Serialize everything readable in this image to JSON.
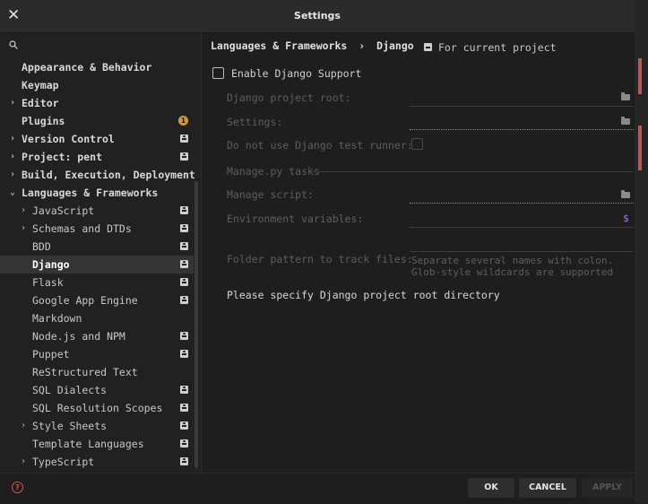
{
  "window": {
    "title": "Settings"
  },
  "search": {
    "placeholder": ""
  },
  "sidebar": {
    "items": [
      {
        "label": "Appearance & Behavior"
      },
      {
        "label": "Keymap"
      },
      {
        "label": "Editor"
      },
      {
        "label": "Plugins",
        "badge": "1"
      },
      {
        "label": "Version Control"
      },
      {
        "label": "Project: pent"
      },
      {
        "label": "Build, Execution, Deployment"
      },
      {
        "label": "Languages & Frameworks"
      },
      {
        "label": "JavaScript"
      },
      {
        "label": "Schemas and DTDs"
      },
      {
        "label": "BDD"
      },
      {
        "label": "Django"
      },
      {
        "label": "Flask"
      },
      {
        "label": "Google App Engine"
      },
      {
        "label": "Markdown"
      },
      {
        "label": "Node.js and NPM"
      },
      {
        "label": "Puppet"
      },
      {
        "label": "ReStructured Text"
      },
      {
        "label": "SQL Dialects"
      },
      {
        "label": "SQL Resolution Scopes"
      },
      {
        "label": "Style Sheets"
      },
      {
        "label": "Template Languages"
      },
      {
        "label": "TypeScript"
      }
    ]
  },
  "breadcrumb": {
    "parent": "Languages & Frameworks",
    "separator": "›",
    "current": "Django"
  },
  "scope": {
    "label": "For current project"
  },
  "form": {
    "enable_label": "Enable Django Support",
    "project_root_label": "Django project root:",
    "settings_label": "Settings:",
    "test_runner_label": "Do not use Django test runner:",
    "manage_section": "Manage.py tasks",
    "manage_script_label": "Manage script:",
    "env_label": "Environment variables:",
    "env_icon": "$",
    "folder_pattern_label": "Folder pattern to track files:",
    "folder_pattern_hint_1": "Separate several names with colon.",
    "folder_pattern_hint_2": "Glob-style wildcards are supported",
    "message": "Please specify Django project root directory"
  },
  "footer": {
    "help": "?",
    "ok": "OK",
    "cancel": "CANCEL",
    "apply": "APPLY"
  },
  "colors": {
    "badge": "#d99a1d",
    "help": "#d9534f",
    "env_icon": "#9b7bd0",
    "selected_bg": "#343434"
  }
}
